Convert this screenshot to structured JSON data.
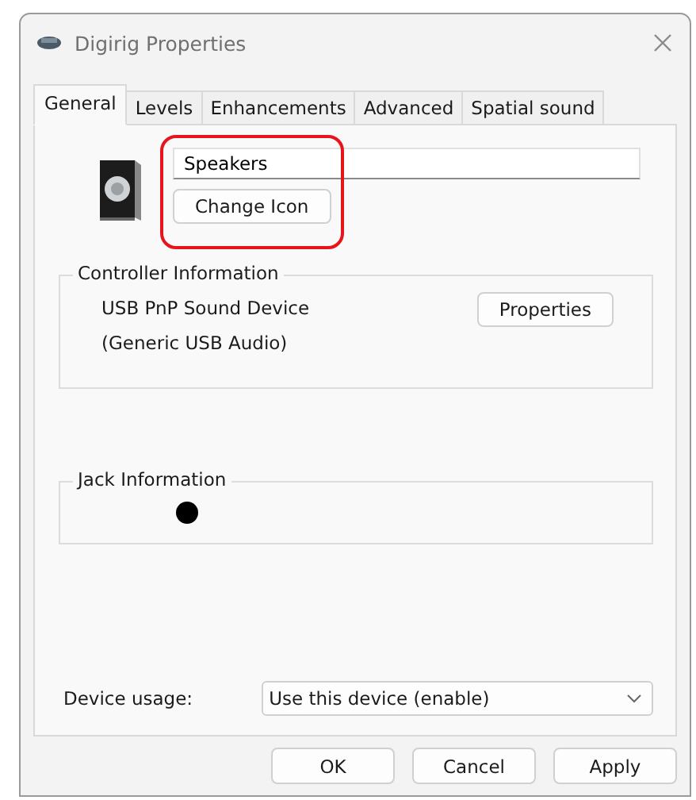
{
  "window": {
    "title": "Digirig Properties"
  },
  "tabs": [
    {
      "label": "General",
      "selected": true
    },
    {
      "label": "Levels",
      "selected": false
    },
    {
      "label": "Enhancements",
      "selected": false
    },
    {
      "label": "Advanced",
      "selected": false
    },
    {
      "label": "Spatial sound",
      "selected": false
    }
  ],
  "name_field": {
    "value": "Speakers"
  },
  "change_icon_button": "Change Icon",
  "controller": {
    "title": "Controller Information",
    "name": "USB PnP Sound Device",
    "driver": "(Generic USB Audio)",
    "button": "Properties"
  },
  "jack": {
    "title": "Jack Information"
  },
  "device_usage": {
    "label": "Device usage:",
    "value": "Use this device (enable)"
  },
  "buttons": [
    "OK",
    "Cancel",
    "Apply"
  ]
}
